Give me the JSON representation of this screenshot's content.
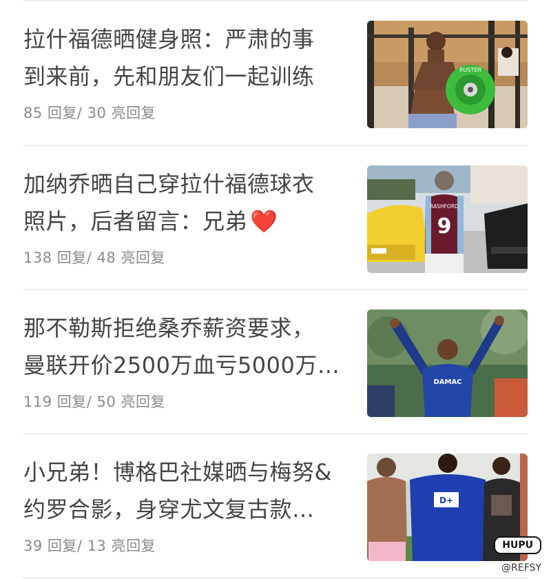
{
  "feed": {
    "items": [
      {
        "title_line1": "拉什福德晒健身照：严肃的事",
        "title_line2": "到来前，先和朋友们一起训练",
        "replies": "85",
        "reply_label": "回复/",
        "lit": "30",
        "lit_label": "亮回复",
        "thumb_icon": "gym-weight-plate-photo"
      },
      {
        "title_line1": "加纳乔晒自己穿拉什福德球衣",
        "title_line2": "照片，后者留言：兄弟",
        "title_emoji": "❤️",
        "replies": "138",
        "reply_label": "回复/",
        "lit": "48",
        "lit_label": "亮回复",
        "jersey_name": "RASHFORD",
        "jersey_number": "9",
        "thumb_icon": "jersey-back-photo"
      },
      {
        "title_line1": "那不勒斯拒绝桑乔薪资要求，",
        "title_line2": "曼联开价2500万血亏5000万…",
        "replies": "119",
        "reply_label": "回复/",
        "lit": "50",
        "lit_label": "亮回复",
        "sponsor": "DAMAC",
        "thumb_icon": "player-celebration-photo"
      },
      {
        "title_line1": "小兄弟！博格巴社媒晒与梅努&",
        "title_line2": "约罗合影，身穿尤文复古款…",
        "replies": "39",
        "reply_label": "回复/",
        "lit": "13",
        "lit_label": "亮回复",
        "sponsor": "D+",
        "thumb_icon": "group-photo"
      }
    ]
  },
  "watermark": {
    "logo": "HUPU",
    "handle": "@REFSY"
  },
  "colors": {
    "title": "#444444",
    "meta": "#8a8a8a",
    "divider": "#ececec",
    "heart": "#e8322f"
  }
}
